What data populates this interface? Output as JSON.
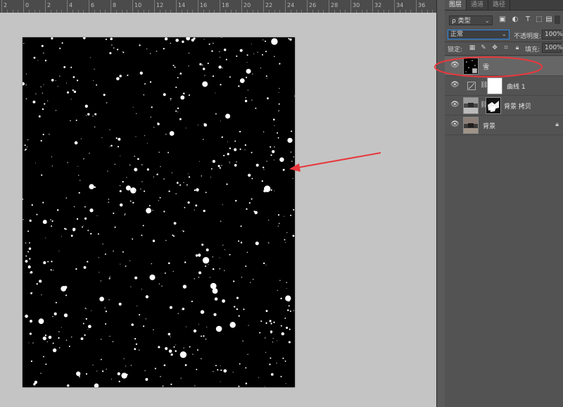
{
  "ruler": {
    "labels": [
      "2",
      "0",
      "2",
      "4",
      "6",
      "8",
      "10",
      "12",
      "14",
      "16",
      "18",
      "20",
      "22",
      "24",
      "26",
      "28",
      "30",
      "32",
      "34",
      "36"
    ]
  },
  "panel": {
    "tabs": [
      "图层",
      "通道",
      "路径"
    ],
    "filter_label": "ρ 类型",
    "blend_mode": "正常",
    "opacity_label": "不透明度:",
    "opacity_value": "100%",
    "lock_label": "锁定:",
    "fill_label": "填充:",
    "fill_value": "100%"
  },
  "layers": [
    {
      "name": "雪",
      "selected": true
    },
    {
      "name": "曲线 1",
      "selected": false
    },
    {
      "name": "背景 拷贝",
      "selected": false
    },
    {
      "name": "背景",
      "selected": false,
      "locked": true
    }
  ],
  "colors": {
    "annotation": "#e8383d",
    "canvas_bg": "#c4c4c4",
    "panel_bg": "#535353"
  },
  "icons": {
    "eye": "eye-icon",
    "link": "chain-link-icon",
    "lock": "lock-icon"
  }
}
